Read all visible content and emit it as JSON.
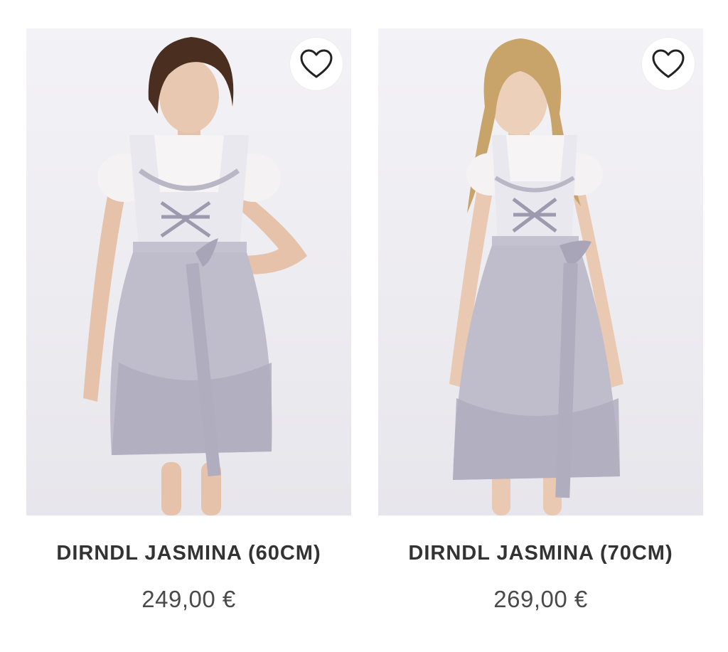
{
  "products": [
    {
      "name": "DIRNDL JASMINA (60CM)",
      "price": "249,00 €",
      "wishlist_icon": "heart-outline-icon",
      "hair_color": "#4a2e1f"
    },
    {
      "name": "DIRNDL JASMINA (70CM)",
      "price": "269,00 €",
      "wishlist_icon": "heart-outline-icon",
      "hair_color": "#c9a46a"
    }
  ],
  "colors": {
    "dress_lavender": "#b9b6c6",
    "lace_white": "#f4f2f3",
    "text_dark": "#333333",
    "photo_bg": "#efeef2"
  }
}
